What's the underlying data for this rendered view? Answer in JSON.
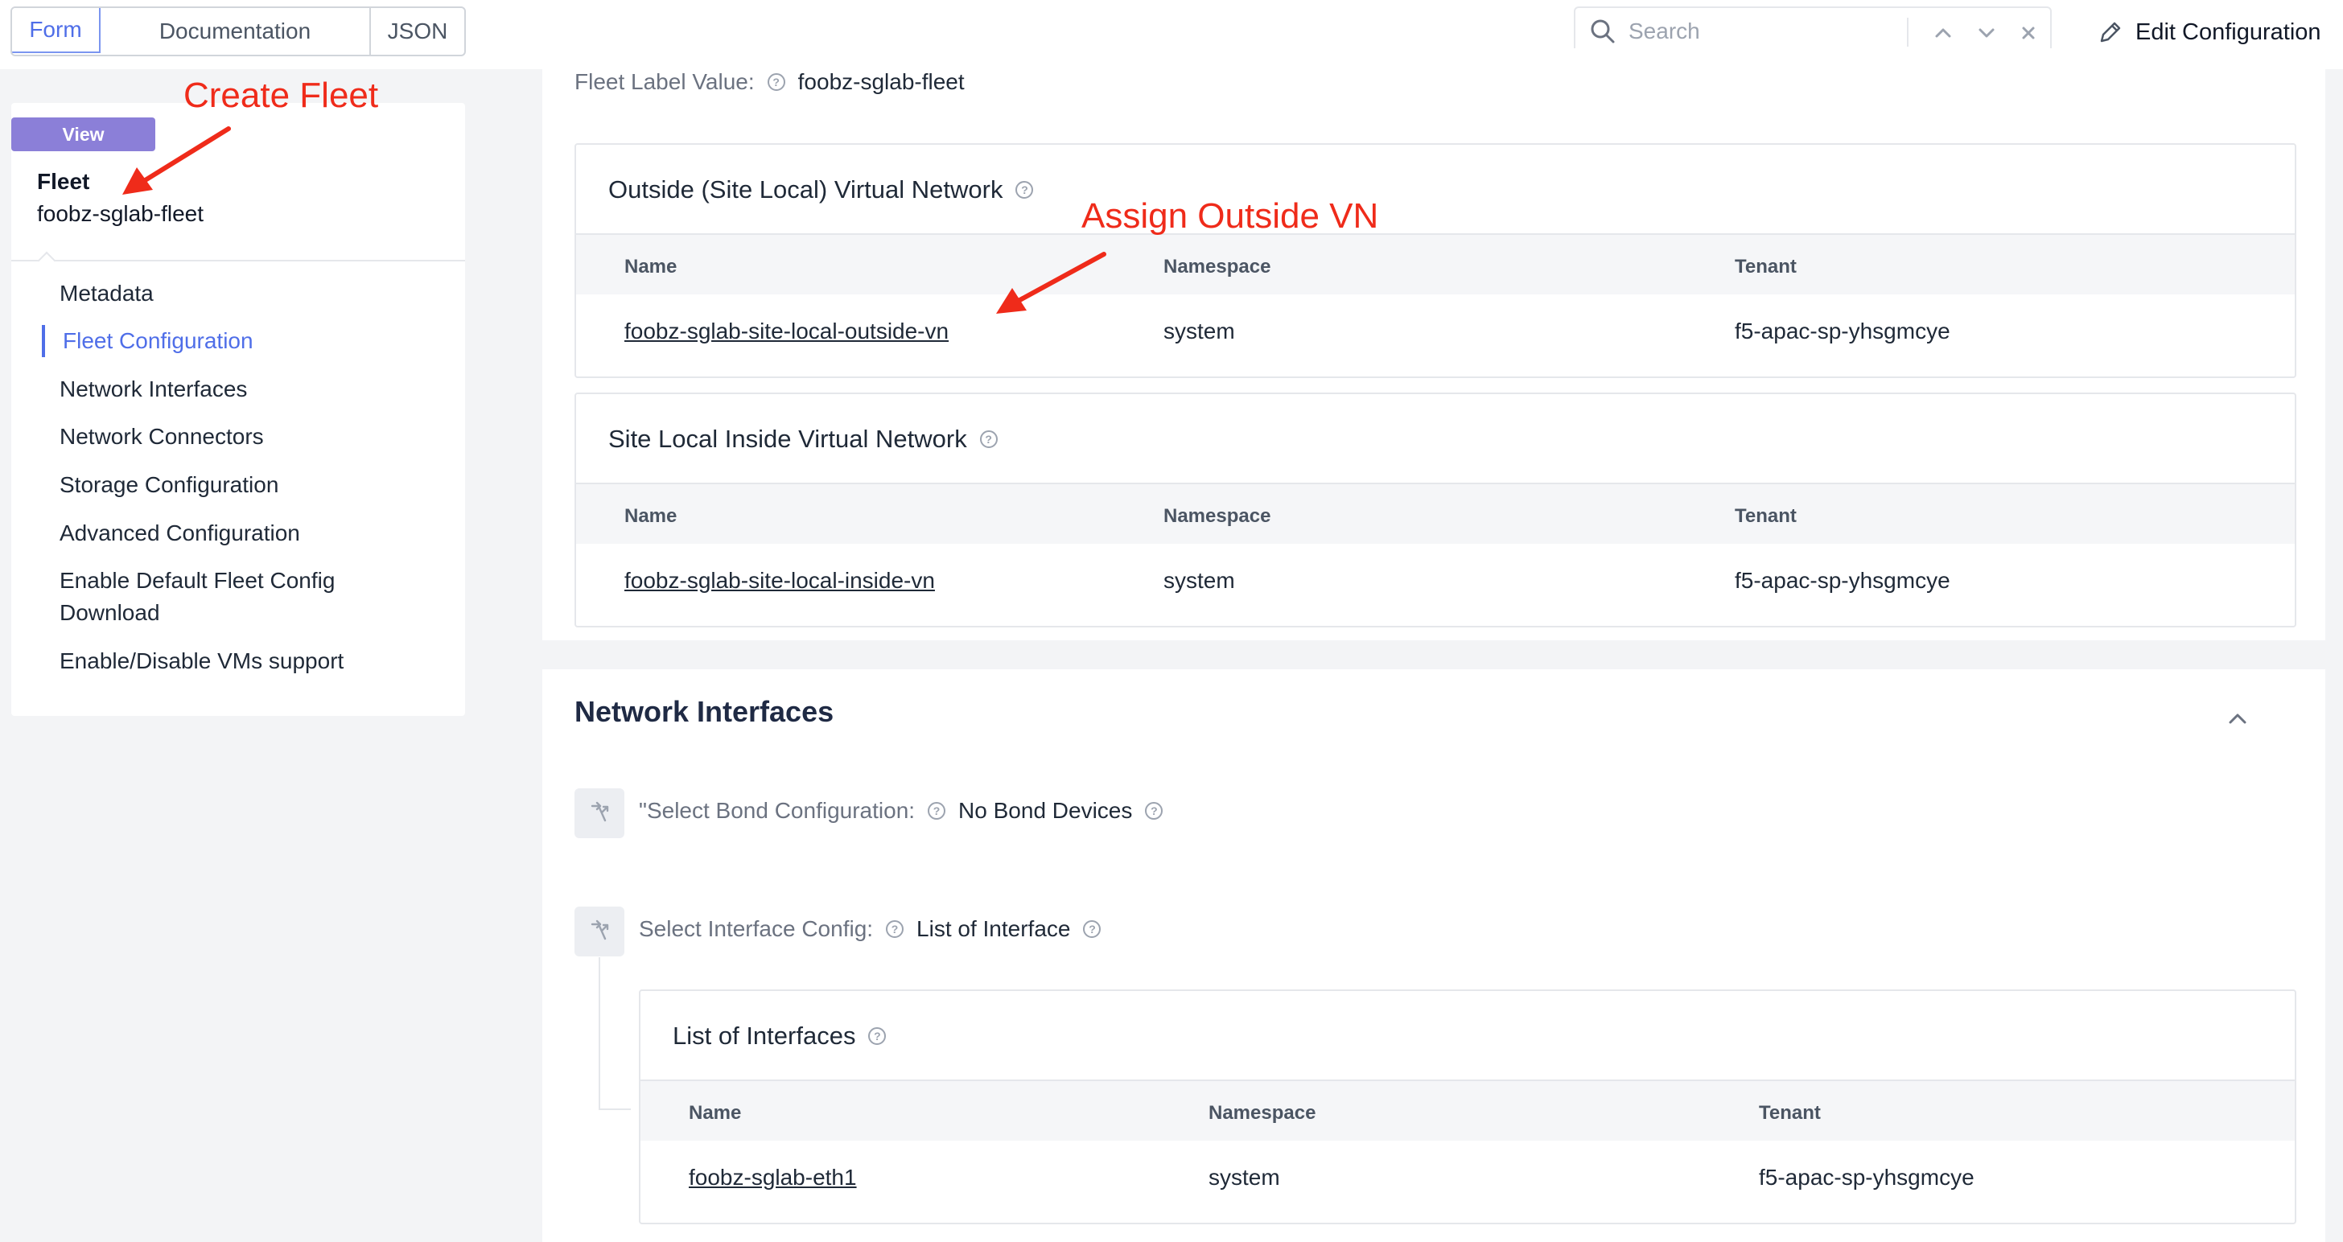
{
  "toolbar": {
    "tabs": [
      "Form",
      "Documentation",
      "JSON"
    ],
    "search_placeholder": "Search",
    "edit_label": "Edit Configuration"
  },
  "sidebar": {
    "badge": "View",
    "type": "Fleet",
    "name": "foobz-sglab-fleet",
    "items": [
      "Metadata",
      "Fleet Configuration",
      "Network Interfaces",
      "Network Connectors",
      "Storage Configuration",
      "Advanced Configuration",
      "Enable Default Fleet Config Download",
      "Enable/Disable VMs support"
    ],
    "active_item": "Fleet Configuration"
  },
  "main": {
    "fleet_label": {
      "label": "Fleet Label Value:",
      "value": "foobz-sglab-fleet"
    },
    "outside_vn": {
      "title": "Outside (Site Local) Virtual Network",
      "columns": [
        "Name",
        "Namespace",
        "Tenant"
      ],
      "row": {
        "name": "foobz-sglab-site-local-outside-vn",
        "namespace": "system",
        "tenant": "f5-apac-sp-yhsgmcye"
      }
    },
    "inside_vn": {
      "title": "Site Local Inside Virtual Network",
      "columns": [
        "Name",
        "Namespace",
        "Tenant"
      ],
      "row": {
        "name": "foobz-sglab-site-local-inside-vn",
        "namespace": "system",
        "tenant": "f5-apac-sp-yhsgmcye"
      }
    },
    "network_interfaces": {
      "title": "Network Interfaces",
      "bond": {
        "label": "\"Select Bond Configuration:",
        "value": "No Bond Devices"
      },
      "interface": {
        "label": "Select Interface Config:",
        "value": "List of Interface"
      },
      "list": {
        "title": "List of Interfaces",
        "columns": [
          "Name",
          "Namespace",
          "Tenant"
        ],
        "row": {
          "name": "foobz-sglab-eth1",
          "namespace": "system",
          "tenant": "f5-apac-sp-yhsgmcye"
        }
      }
    }
  },
  "annotations": {
    "create_fleet": "Create Fleet",
    "assign_outside_vn": "Assign Outside VN"
  },
  "colors": {
    "accent": "#4f6ee8",
    "badge": "#8b7fd8",
    "annotation": "#ef2b1a"
  }
}
